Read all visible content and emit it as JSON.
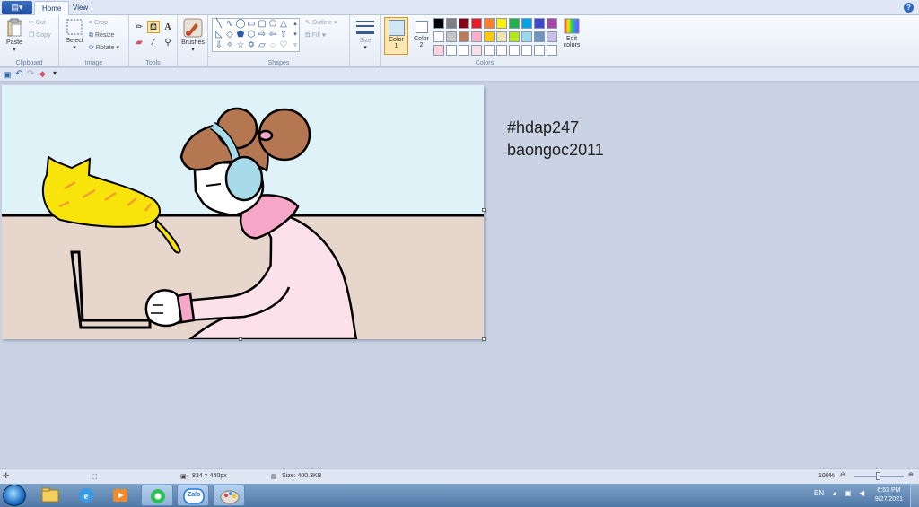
{
  "menu": {
    "app_button_icon": "paint-menu-icon",
    "tabs": [
      "Home",
      "View"
    ],
    "help": "?"
  },
  "ribbon": {
    "clipboard": {
      "label": "Clipboard",
      "paste": "Paste",
      "cut": "Cut",
      "copy": "Copy"
    },
    "image": {
      "label": "Image",
      "select": "Select",
      "crop": "Crop",
      "resize": "Resize",
      "rotate": "Rotate"
    },
    "tools": {
      "label": "Tools"
    },
    "brushes": {
      "label": "Brushes"
    },
    "shapes": {
      "label": "Shapes",
      "outline": "Outline",
      "fill": "Fill"
    },
    "size": {
      "label": "Size"
    },
    "colors": {
      "label": "Colors",
      "color1_label": "Color",
      "color1_num": "1",
      "color2_label": "Color",
      "color2_num": "2",
      "color1_value": "#cfe6f5",
      "color2_value": "#ffffff",
      "edit": "Edit",
      "edit2": "colors",
      "palette_row1": [
        "#000000",
        "#7f7f7f",
        "#880015",
        "#ed1c24",
        "#ff7f27",
        "#fff200",
        "#22b14c",
        "#00a2e8",
        "#3f48cc",
        "#a349a4"
      ],
      "palette_row2": [
        "#ffffff",
        "#c3c3c3",
        "#b97a57",
        "#ffaec9",
        "#ffc90e",
        "#efe4b0",
        "#b5e61d",
        "#99d9ea",
        "#7092be",
        "#c8bfe7"
      ],
      "palette_row3": [
        "#ffd1dc",
        "#ffffff",
        "#ffffff",
        "#f9dfe4",
        "#ffffff",
        "#ffffff",
        "#ffffff",
        "#ffffff",
        "#ffffff",
        "#ffffff"
      ]
    }
  },
  "canvas": {
    "overlay_line1": "#hdap247",
    "overlay_line2": "baongoc2011"
  },
  "status": {
    "dimensions": "834 × 440px",
    "size": "Size: 400.3KB",
    "zoom": "100%"
  },
  "taskbar": {
    "language": "EN",
    "time": "6:53 PM",
    "date": "9/27/2021",
    "zalo": "Zalo"
  }
}
